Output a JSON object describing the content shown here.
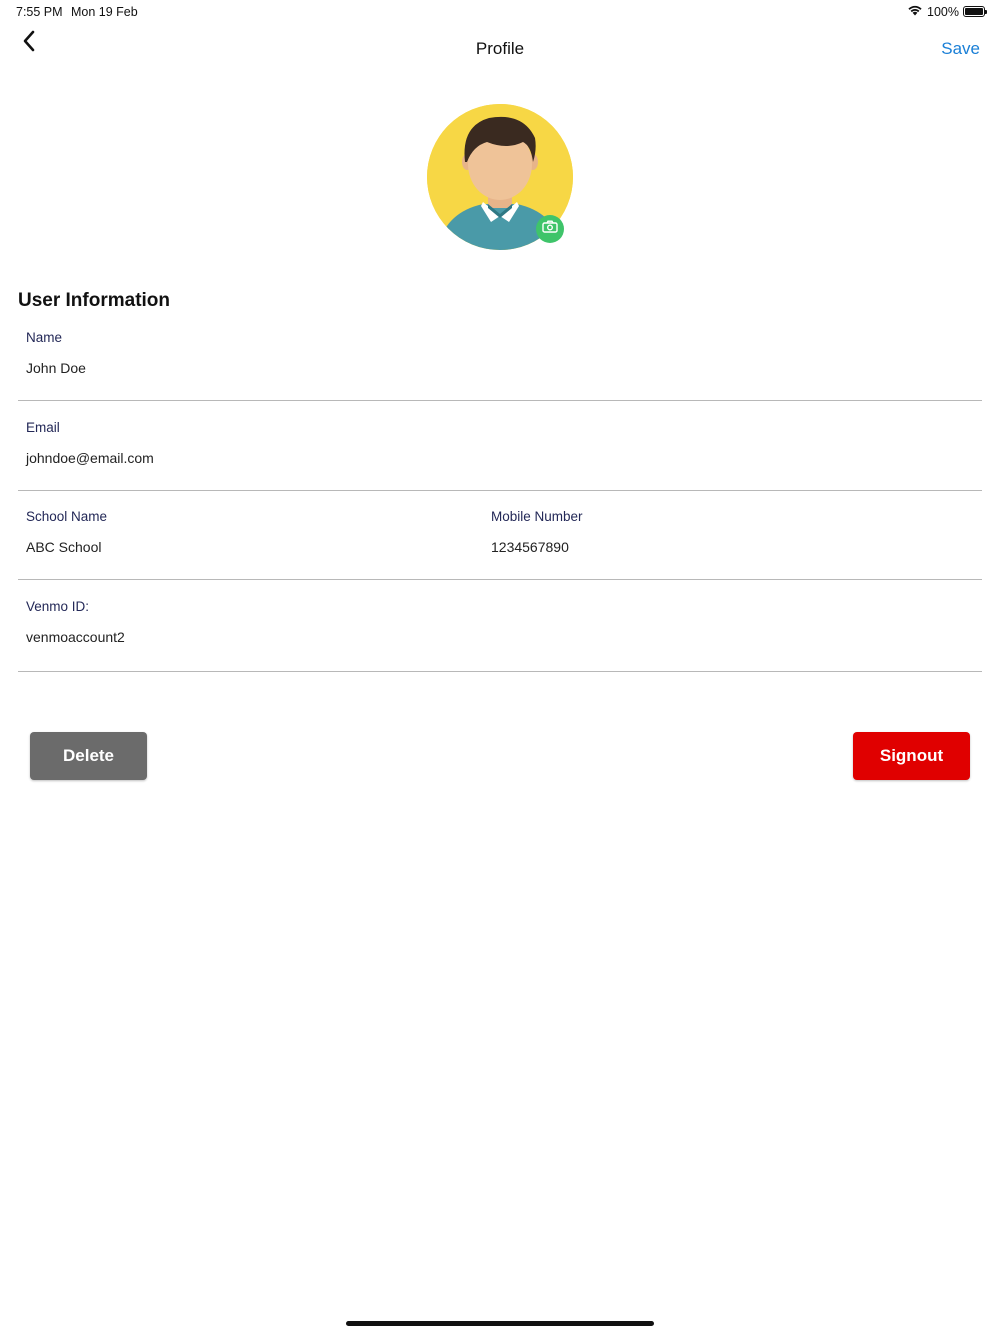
{
  "status_bar": {
    "time": "7:55 PM",
    "date": "Mon 19 Feb",
    "battery": "100%",
    "icons": [
      "wifi-icon",
      "battery-icon"
    ]
  },
  "nav": {
    "title": "Profile",
    "save_label": "Save",
    "back_icon": "chevron-left-icon"
  },
  "avatar": {
    "icon": "user-avatar",
    "camera_icon": "camera-icon"
  },
  "section_title": "User Information",
  "fields": {
    "name": {
      "label": "Name",
      "value": "John Doe"
    },
    "email": {
      "label": "Email",
      "value": "johndoe@email.com"
    },
    "school": {
      "label": "School Name",
      "value": "ABC School"
    },
    "mobile": {
      "label": "Mobile Number",
      "value": "1234567890"
    },
    "venmo": {
      "label": "Venmo ID:",
      "value": "venmoaccount2"
    }
  },
  "buttons": {
    "delete": "Delete",
    "signout": "Signout"
  },
  "colors": {
    "accent": "#1a7fd6",
    "label": "#232857",
    "delete": "#6b6b6b",
    "signout": "#e00000",
    "avatar_bg": "#f7d745",
    "camera": "#3fc46a"
  }
}
